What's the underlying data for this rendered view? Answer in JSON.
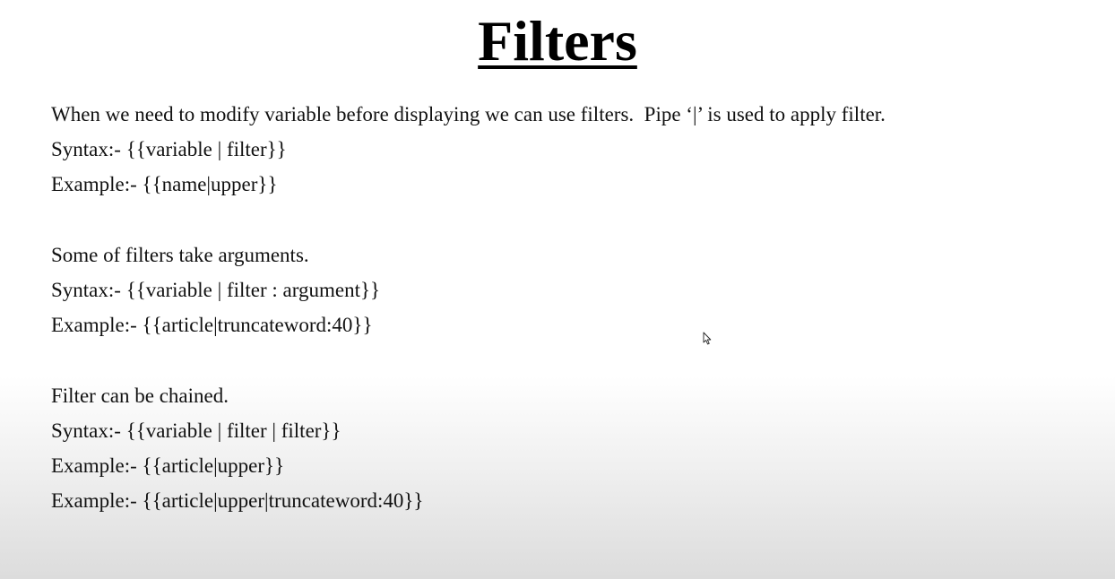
{
  "slide": {
    "title": "Filters",
    "sections": [
      {
        "lines": [
          "When we need to modify variable before displaying we can use filters.  Pipe ‘|’ is used to apply filter.",
          "Syntax:- {{variable | filter}}",
          "Example:- {{name|upper}}"
        ]
      },
      {
        "lines": [
          "Some of filters take arguments.",
          "Syntax:- {{variable | filter : argument}}",
          "Example:- {{article|truncateword:40}}"
        ]
      },
      {
        "lines": [
          "Filter can be chained.",
          "Syntax:- {{variable | filter | filter}}",
          "Example:- {{article|upper}}",
          "Example:- {{article|upper|truncateword:40}}"
        ]
      }
    ]
  },
  "cursor_icon": "mouse-pointer-icon"
}
